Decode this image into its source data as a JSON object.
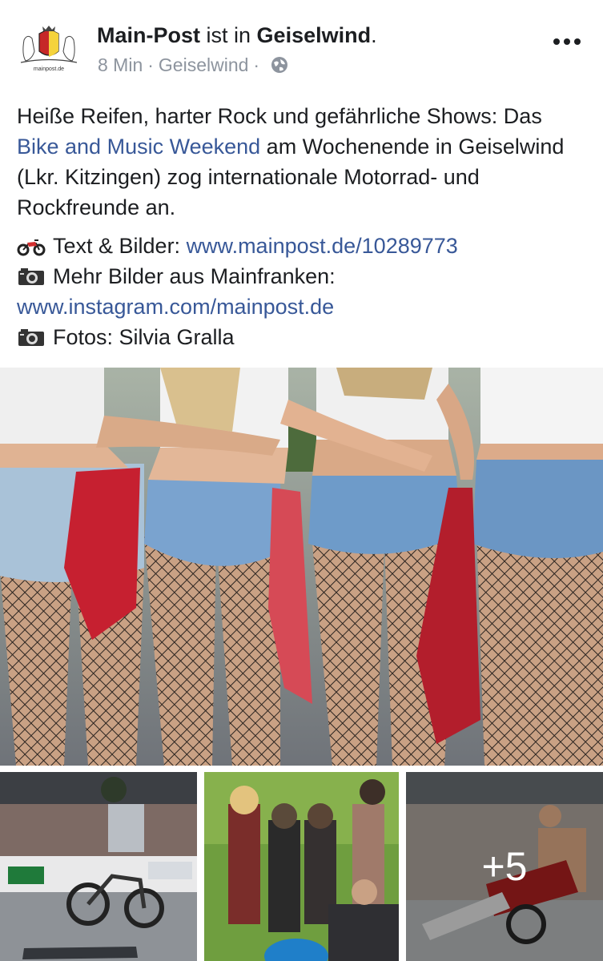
{
  "post": {
    "author": "Main-Post",
    "connector": " ist in ",
    "place": "Geiselwind",
    "period": ".",
    "time": "8 Min",
    "meta_sep": "·",
    "location": "Geiselwind",
    "meta_sep2": "·",
    "audience_icon": "globe-icon",
    "avatar_caption": "mainpost.de",
    "text_1": "Heiße Reifen, harter Rock und gefährliche Shows: Das ",
    "text_link": "Bike and Music Weekend",
    "text_2": " am Wochenende in Geiselwind (Lkr. Kitzingen) zog internationale Motorrad- und Rockfreunde an.",
    "line1_icon": "motorcycle-icon",
    "line1_label": "Text & Bilder: ",
    "line1_link": "www.mainpost.de/10289773",
    "line2_icon": "camera-icon",
    "line2_label": "Mehr Bilder aus Mainfranken:",
    "line3_link": "www.instagram.com/mainpost.de",
    "line4_icon": "camera-icon",
    "line4_label": "Fotos: Silvia Gralla",
    "more_photos": "+5"
  },
  "colors": {
    "link": "#385898",
    "text": "#1c1e21",
    "meta": "#8d949e"
  }
}
